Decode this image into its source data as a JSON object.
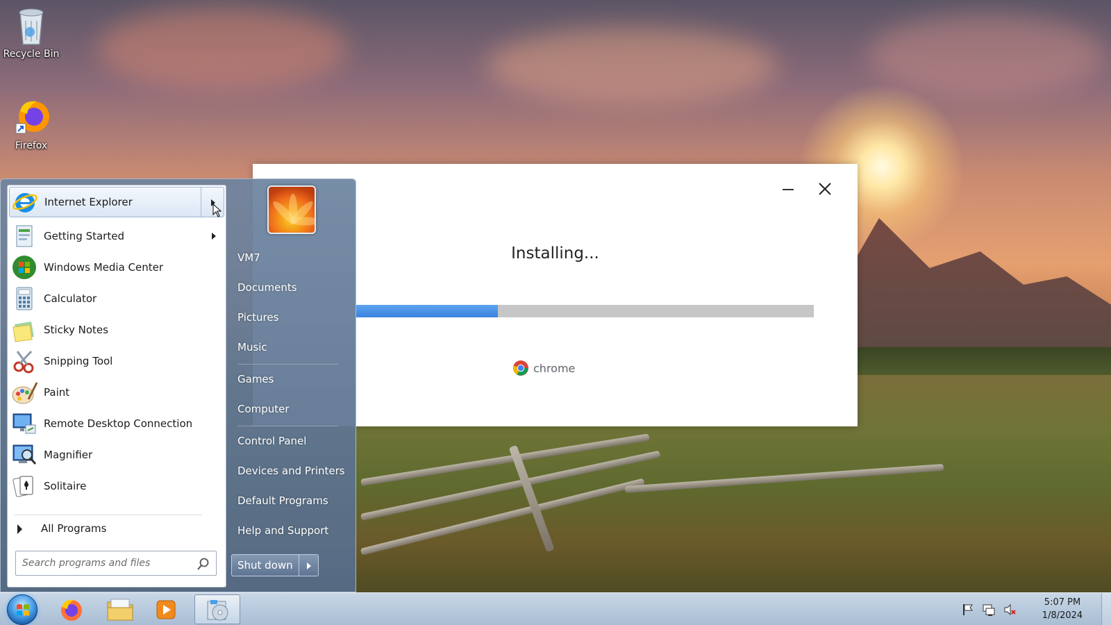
{
  "desktop": {
    "icons": [
      {
        "label": "Recycle Bin",
        "icon": "recycle-bin-icon"
      },
      {
        "label": "Firefox",
        "icon": "firefox-icon"
      }
    ]
  },
  "installer": {
    "status": "Installing...",
    "progress": 0.31,
    "brand": "chrome",
    "accent": "#3a83df",
    "track": "#c6c6c6"
  },
  "start_menu": {
    "programs": [
      {
        "label": "Internet Explorer",
        "icon": "internet-explorer-icon",
        "submenu": true,
        "selected": true
      },
      {
        "label": "Getting Started",
        "icon": "getting-started-icon",
        "submenu": true
      },
      {
        "label": "Windows Media Center",
        "icon": "windows-media-center-icon"
      },
      {
        "label": "Calculator",
        "icon": "calculator-icon"
      },
      {
        "label": "Sticky Notes",
        "icon": "sticky-notes-icon"
      },
      {
        "label": "Snipping Tool",
        "icon": "snipping-tool-icon"
      },
      {
        "label": "Paint",
        "icon": "paint-icon"
      },
      {
        "label": "Remote Desktop Connection",
        "icon": "remote-desktop-icon"
      },
      {
        "label": "Magnifier",
        "icon": "magnifier-icon"
      },
      {
        "label": "Solitaire",
        "icon": "solitaire-icon"
      }
    ],
    "all_programs": "All Programs",
    "search_placeholder": "Search programs and files",
    "places": [
      {
        "label": "VM7"
      },
      {
        "label": "Documents"
      },
      {
        "label": "Pictures"
      },
      {
        "label": "Music"
      },
      {
        "label": "Games"
      },
      {
        "label": "Computer"
      },
      {
        "label": "Control Panel"
      },
      {
        "label": "Devices and Printers"
      },
      {
        "label": "Default Programs"
      },
      {
        "label": "Help and Support"
      }
    ],
    "shutdown_label": "Shut down"
  },
  "taskbar": {
    "pinned": [
      {
        "icon": "firefox-icon"
      },
      {
        "icon": "file-explorer-icon"
      },
      {
        "icon": "media-player-icon"
      },
      {
        "icon": "installer-icon",
        "active": true
      }
    ],
    "tray": [
      {
        "icon": "action-center-flag-icon"
      },
      {
        "icon": "network-icon"
      },
      {
        "icon": "volume-muted-icon"
      }
    ],
    "time": "5:07 PM",
    "date": "1/8/2024"
  }
}
